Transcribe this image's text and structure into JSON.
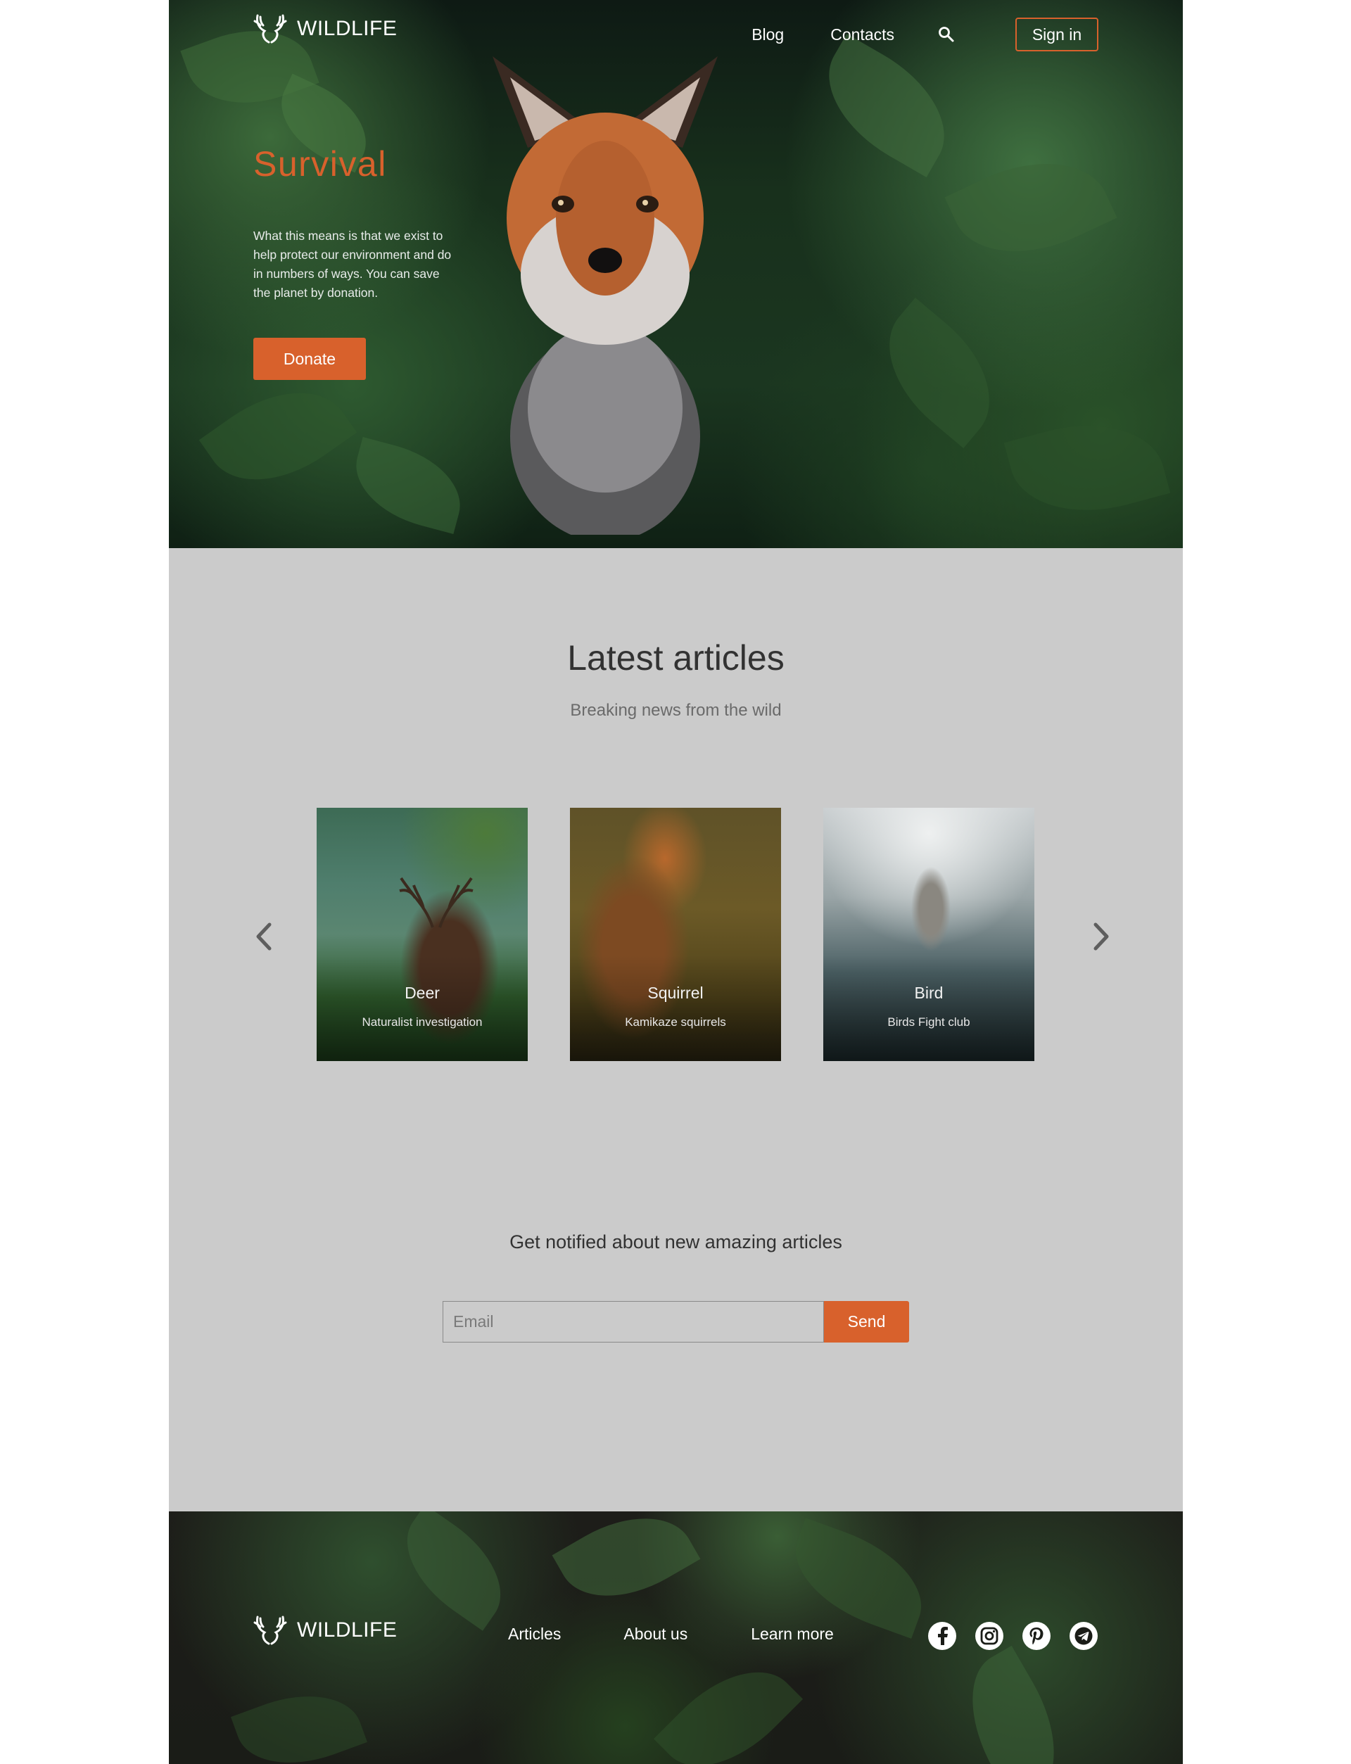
{
  "brand": {
    "name": "WILDLIFE",
    "logo_icon": "antlers-logo-icon"
  },
  "nav": {
    "links": [
      "Blog",
      "Contacts"
    ],
    "search_icon": "search-icon",
    "signin_label": "Sign in"
  },
  "hero": {
    "title": "Survival",
    "text": "What this means is that we exist to help protect our environment and do in numbers of ways. You can save the planet by donation.",
    "donate_label": "Donate"
  },
  "articles": {
    "title": "Latest articles",
    "subtitle": "Breaking news from the wild",
    "prev_icon": "chevron-left-icon",
    "next_icon": "chevron-right-icon",
    "cards": [
      {
        "title": "Deer",
        "subtitle": "Naturalist investigation"
      },
      {
        "title": "Squirrel",
        "subtitle": "Kamikaze squirrels"
      },
      {
        "title": "Bird",
        "subtitle": "Birds Fight club"
      }
    ]
  },
  "newsletter": {
    "title": "Get notified about new amazing articles",
    "email_placeholder": "Email",
    "send_label": "Send"
  },
  "footer": {
    "brand": "WILDLIFE",
    "links": [
      "Articles",
      "About us",
      "Learn more"
    ],
    "socials": [
      "facebook-icon",
      "instagram-icon",
      "pinterest-icon",
      "telegram-icon"
    ]
  },
  "colors": {
    "accent": "#d8612c",
    "page_bg": "#cbcbcb",
    "heading": "#323232"
  }
}
